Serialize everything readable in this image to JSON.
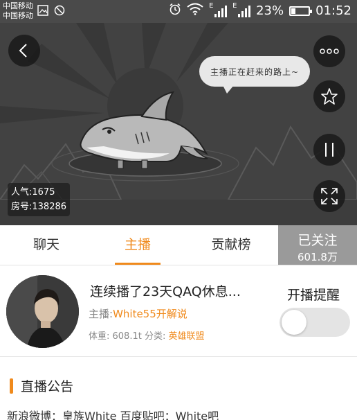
{
  "status_bar": {
    "carrier_1": "中国移动",
    "carrier_2": "中国移动",
    "network_1": "E",
    "network_2": "E",
    "battery": "23%",
    "battery_level": 0.23,
    "time": "01:52",
    "icons": [
      "image-icon",
      "no-disturb-icon",
      "alarm-icon",
      "wifi-icon",
      "signal-icon",
      "signal-icon",
      "battery-icon"
    ]
  },
  "player": {
    "bubble_text": "主播正在赶来的路上~",
    "popularity": "人气:1675",
    "room_number": "房号:138286",
    "icons": [
      "back-arrow-icon",
      "more-dots-icon",
      "star-icon",
      "pause-icon",
      "fullscreen-icon"
    ]
  },
  "tabs": [
    {
      "label": "聊天"
    },
    {
      "label": "主播",
      "active": true
    },
    {
      "label": "贡献榜"
    }
  ],
  "follow": {
    "label": "已关注",
    "count": "601.8万"
  },
  "streamer": {
    "room_title": "连续播了23天QAQ休息...",
    "host_prefix": "主播:",
    "host_name": "White55开解说",
    "weight": "体重: 608.1t",
    "category_prefix": "分类:",
    "category": "英雄联盟",
    "remind_label": "开播提醒",
    "remind_on": false
  },
  "announcement": {
    "title": "直播公告",
    "body": "新浪微博：皇族White 百度贴吧：White吧"
  },
  "colors": {
    "accent": "#f08a1c",
    "follow_bg": "#9a9a9a",
    "status_bg": "#4a4a4a"
  }
}
